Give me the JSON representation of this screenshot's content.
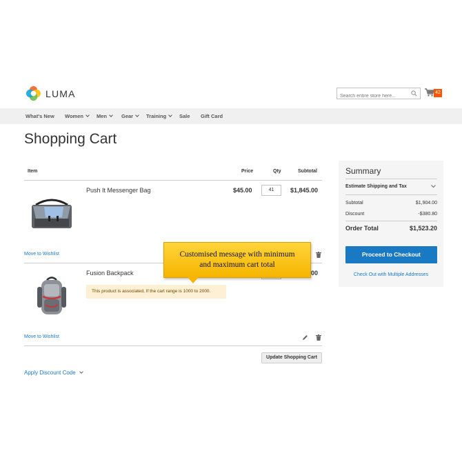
{
  "header": {
    "logo_text": "LUMA",
    "search_placeholder": "Search entire store here...",
    "cart_count": "42"
  },
  "nav": {
    "items": [
      {
        "label": "What's New"
      },
      {
        "label": "Women"
      },
      {
        "label": "Men"
      },
      {
        "label": "Gear"
      },
      {
        "label": "Training"
      },
      {
        "label": "Sale"
      },
      {
        "label": "Gift Card"
      }
    ]
  },
  "page_title": "Shopping Cart",
  "cart": {
    "headers": {
      "item": "Item",
      "price": "Price",
      "qty": "Qty",
      "subtotal": "Subtotal"
    },
    "items": [
      {
        "name": "Push It Messenger Bag",
        "price": "$45.00",
        "qty": "41",
        "subtotal": "$1,845.00",
        "wishlist": "Move to Wishlist"
      },
      {
        "name": "Fusion Backpack",
        "subtotal_partial": "00",
        "wishlist": "Move to Wishlist",
        "notice": "This product is associated, If the cart range is 1000 to 2000."
      }
    ],
    "update_button": "Update Shopping Cart",
    "discount_link": "Apply Discount Code"
  },
  "summary": {
    "title": "Summary",
    "estimate": "Estimate Shipping and Tax",
    "rows": [
      {
        "label": "Subtotal",
        "value": "$1,904.00"
      },
      {
        "label": "Discount",
        "value": "-$380.80"
      }
    ],
    "total_label": "Order Total",
    "total_value": "$1,523.20",
    "checkout_button": "Proceed to Checkout",
    "multi_link": "Check Out with Multiple Addresses"
  },
  "callout": {
    "line1": "Customised message with minimum",
    "line2": "and maximum cart total"
  }
}
